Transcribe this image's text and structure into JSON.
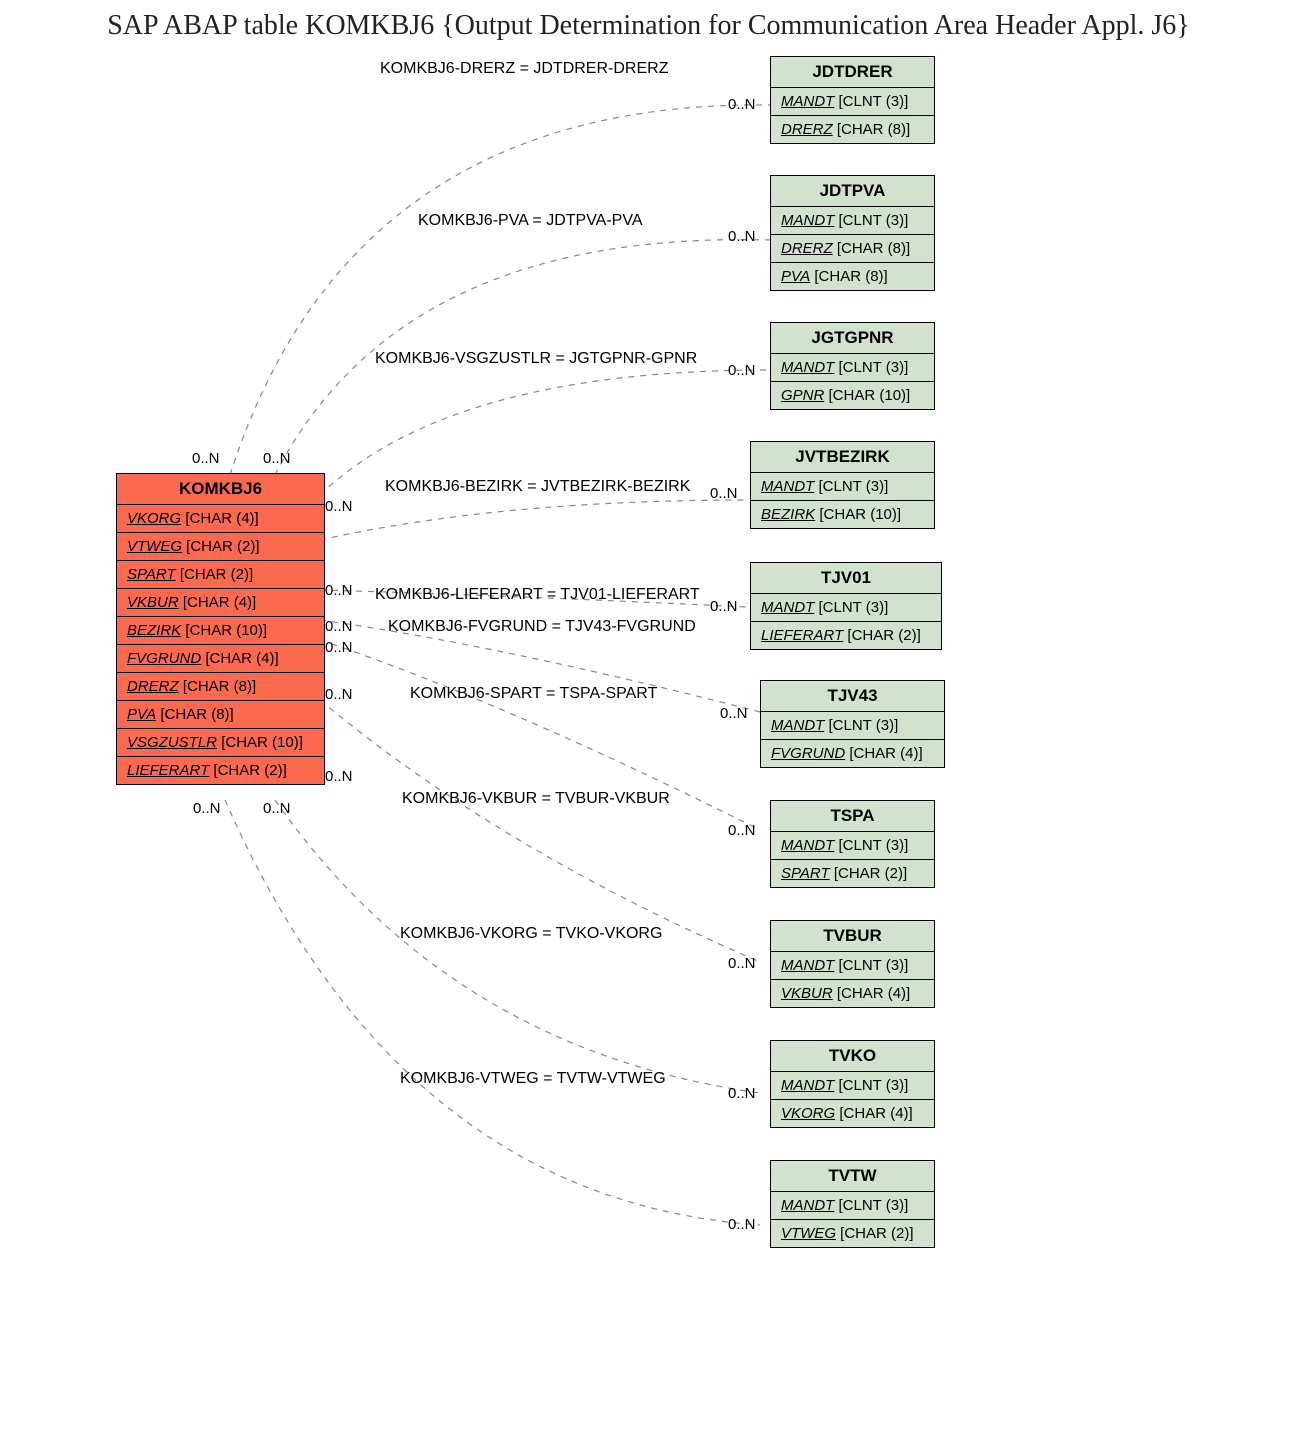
{
  "title": "SAP ABAP table KOMKBJ6 {Output Determination for Communication Area Header Appl. J6}",
  "main_entity": {
    "name": "KOMKBJ6",
    "fields": [
      {
        "name": "VKORG",
        "type": "[CHAR (4)]"
      },
      {
        "name": "VTWEG",
        "type": "[CHAR (2)]"
      },
      {
        "name": "SPART",
        "type": "[CHAR (2)]"
      },
      {
        "name": "VKBUR",
        "type": "[CHAR (4)]"
      },
      {
        "name": "BEZIRK",
        "type": "[CHAR (10)]"
      },
      {
        "name": "FVGRUND",
        "type": "[CHAR (4)]"
      },
      {
        "name": "DRERZ",
        "type": "[CHAR (8)]"
      },
      {
        "name": "PVA",
        "type": "[CHAR (8)]"
      },
      {
        "name": "VSGZUSTLR",
        "type": "[CHAR (10)]"
      },
      {
        "name": "LIEFERART",
        "type": "[CHAR (2)]"
      }
    ]
  },
  "related_entities": [
    {
      "name": "JDTDRER",
      "fields": [
        {
          "name": "MANDT",
          "type": "[CLNT (3)]"
        },
        {
          "name": "DRERZ",
          "type": "[CHAR (8)]"
        }
      ]
    },
    {
      "name": "JDTPVA",
      "fields": [
        {
          "name": "MANDT",
          "type": "[CLNT (3)]"
        },
        {
          "name": "DRERZ",
          "type": "[CHAR (8)]"
        },
        {
          "name": "PVA",
          "type": "[CHAR (8)]"
        }
      ]
    },
    {
      "name": "JGTGPNR",
      "fields": [
        {
          "name": "MANDT",
          "type": "[CLNT (3)]"
        },
        {
          "name": "GPNR",
          "type": "[CHAR (10)]"
        }
      ]
    },
    {
      "name": "JVTBEZIRK",
      "fields": [
        {
          "name": "MANDT",
          "type": "[CLNT (3)]"
        },
        {
          "name": "BEZIRK",
          "type": "[CHAR (10)]"
        }
      ]
    },
    {
      "name": "TJV01",
      "fields": [
        {
          "name": "MANDT",
          "type": "[CLNT (3)]"
        },
        {
          "name": "LIEFERART",
          "type": "[CHAR (2)]"
        }
      ]
    },
    {
      "name": "TJV43",
      "fields": [
        {
          "name": "MANDT",
          "type": "[CLNT (3)]"
        },
        {
          "name": "FVGRUND",
          "type": "[CHAR (4)]"
        }
      ]
    },
    {
      "name": "TSPA",
      "fields": [
        {
          "name": "MANDT",
          "type": "[CLNT (3)]"
        },
        {
          "name": "SPART",
          "type": "[CHAR (2)]"
        }
      ]
    },
    {
      "name": "TVBUR",
      "fields": [
        {
          "name": "MANDT",
          "type": "[CLNT (3)]"
        },
        {
          "name": "VKBUR",
          "type": "[CHAR (4)]"
        }
      ]
    },
    {
      "name": "TVKO",
      "fields": [
        {
          "name": "MANDT",
          "type": "[CLNT (3)]"
        },
        {
          "name": "VKORG",
          "type": "[CHAR (4)]"
        }
      ]
    },
    {
      "name": "TVTW",
      "fields": [
        {
          "name": "MANDT",
          "type": "[CLNT (3)]"
        },
        {
          "name": "VTWEG",
          "type": "[CHAR (2)]"
        }
      ]
    }
  ],
  "relations": [
    {
      "label": "KOMKBJ6-DRERZ = JDTDRER-DRERZ"
    },
    {
      "label": "KOMKBJ6-PVA = JDTPVA-PVA"
    },
    {
      "label": "KOMKBJ6-VSGZUSTLR = JGTGPNR-GPNR"
    },
    {
      "label": "KOMKBJ6-BEZIRK = JVTBEZIRK-BEZIRK"
    },
    {
      "label": "KOMKBJ6-LIEFERART = TJV01-LIEFERART"
    },
    {
      "label": "KOMKBJ6-FVGRUND = TJV43-FVGRUND"
    },
    {
      "label": "KOMKBJ6-SPART = TSPA-SPART"
    },
    {
      "label": "KOMKBJ6-VKBUR = TVBUR-VKBUR"
    },
    {
      "label": "KOMKBJ6-VKORG = TVKO-VKORG"
    },
    {
      "label": "KOMKBJ6-VTWEG = TVTW-VTWEG"
    }
  ],
  "cardinality": "0..N"
}
